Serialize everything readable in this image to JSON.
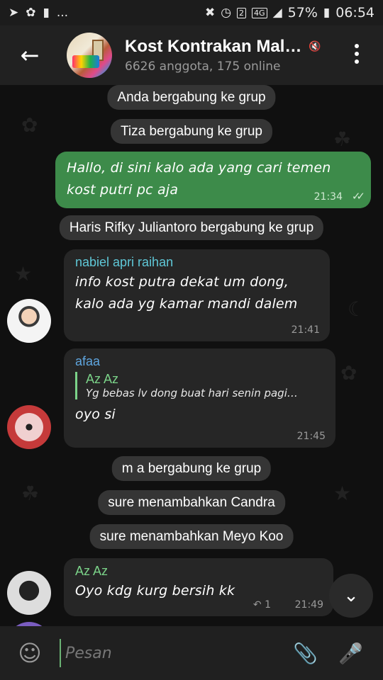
{
  "status_bar": {
    "signal_label": "4G",
    "sim_label": "2",
    "battery": "57%",
    "time": "06:54",
    "ellipsis": "..."
  },
  "header": {
    "title": "Kost Kontrakan Mal…",
    "subtitle": "6626 anggota, 175 online"
  },
  "messages": {
    "s1": "Anda bergabung ke grup",
    "s2": "Tiza bergabung ke grup",
    "out1": {
      "text": "Hallo, di sini kalo ada yang cari temen kost putri pc aja",
      "time": "21:34"
    },
    "s3": "Haris Rifky Juliantoro bergabung ke grup",
    "in1": {
      "sender": "nabiel apri raihan",
      "sender_color": "#5fc8d8",
      "text": "info kost putra dekat um dong, kalo ada yg kamar mandi dalem",
      "time": "21:41"
    },
    "in2": {
      "sender": "afaa",
      "sender_color": "#5fa6e0",
      "reply_name": "Az Az",
      "reply_text": "Yg bebas lv dong buat hari senin pagi…",
      "text": "oyo si",
      "time": "21:45"
    },
    "s4": "m a bergabung ke grup",
    "s5": "sure menambahkan Candra",
    "s6": "sure menambahkan Meyo Koo",
    "in3": {
      "sender": "Az Az",
      "sender_color": "#7bd389",
      "text": "Oyo kdg kurg bersih kk",
      "reply_count": "1",
      "time": "21:49"
    }
  },
  "input": {
    "placeholder": "Pesan"
  },
  "colors": {
    "accent_green": "#3d8b4a",
    "header_bg": "#212121"
  }
}
